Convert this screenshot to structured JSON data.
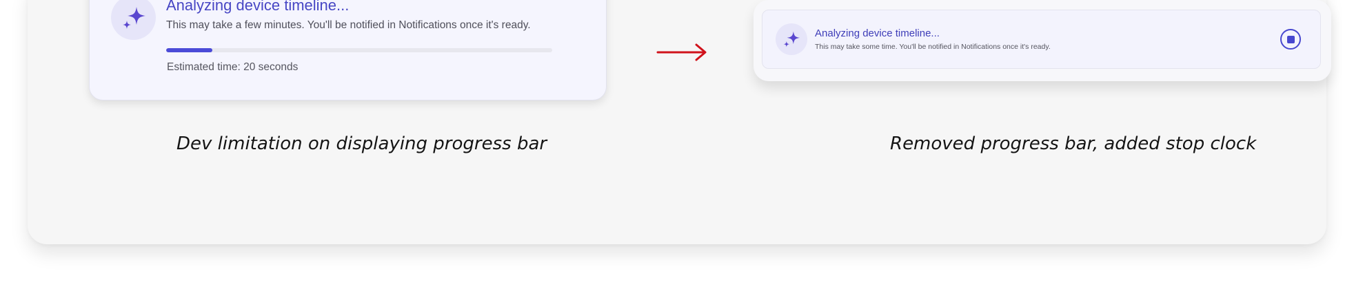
{
  "before": {
    "title": "Analyzing device timeline...",
    "subtitle": "This may take a few minutes. You'll be notified in Notifications once it's ready.",
    "progress_fraction": 0.12,
    "estimate": "Estimated time: 20 seconds",
    "icon": "sparkle-icon",
    "caption": "Dev limitation on displaying progress bar"
  },
  "transition": {
    "icon": "arrow-right-icon",
    "color": "#d0121b"
  },
  "after": {
    "title": "Analyzing device timeline...",
    "subtitle": "This may take some time. You'll be notified in Notifications once it's ready.",
    "icon": "sparkle-icon",
    "stop_icon": "stop-icon",
    "caption": "Removed progress bar, added stop clock"
  },
  "colors": {
    "accent": "#4b4bd8",
    "sparkle": "#5a47cf",
    "badge_bg": "#e6e5f9"
  }
}
